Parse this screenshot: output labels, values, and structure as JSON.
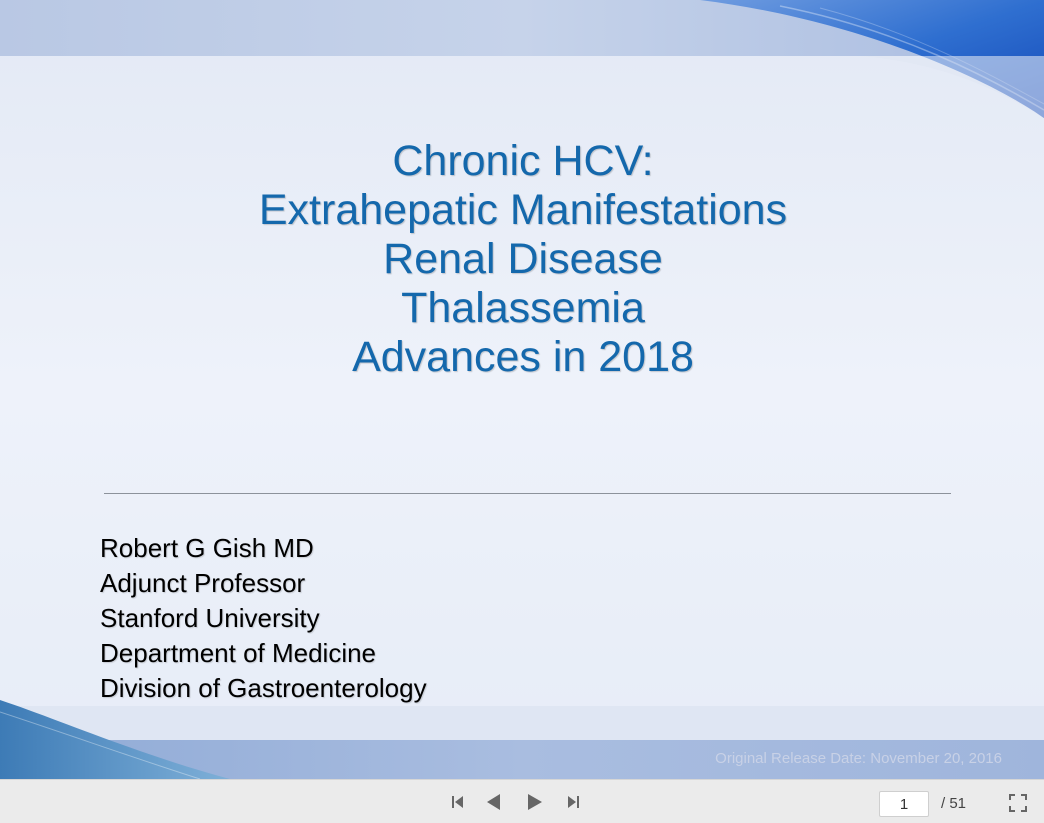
{
  "slide": {
    "title_lines": [
      "Chronic HCV:",
      "Extrahepatic Manifestations",
      "Renal Disease",
      "Thalassemia",
      "Advances in 2018"
    ],
    "author_lines": [
      "Robert G Gish MD",
      "Adjunct Professor",
      "Stanford University",
      "Department of Medicine",
      "Division of Gastroenterology"
    ],
    "release_date": "Original Release Date: November 20, 2016"
  },
  "toolbar": {
    "current_page": "1",
    "total_pages": "/ 51"
  },
  "colors": {
    "title": "#1468ac",
    "body_text": "#000000",
    "toolbar_bg": "#ebebeb",
    "accent_blue": "#1f5fbf"
  },
  "icons": {
    "first": "skip-to-first-icon",
    "prev": "previous-arrow-icon",
    "next": "next-arrow-icon",
    "last": "skip-to-last-icon",
    "fullscreen": "fullscreen-icon"
  }
}
